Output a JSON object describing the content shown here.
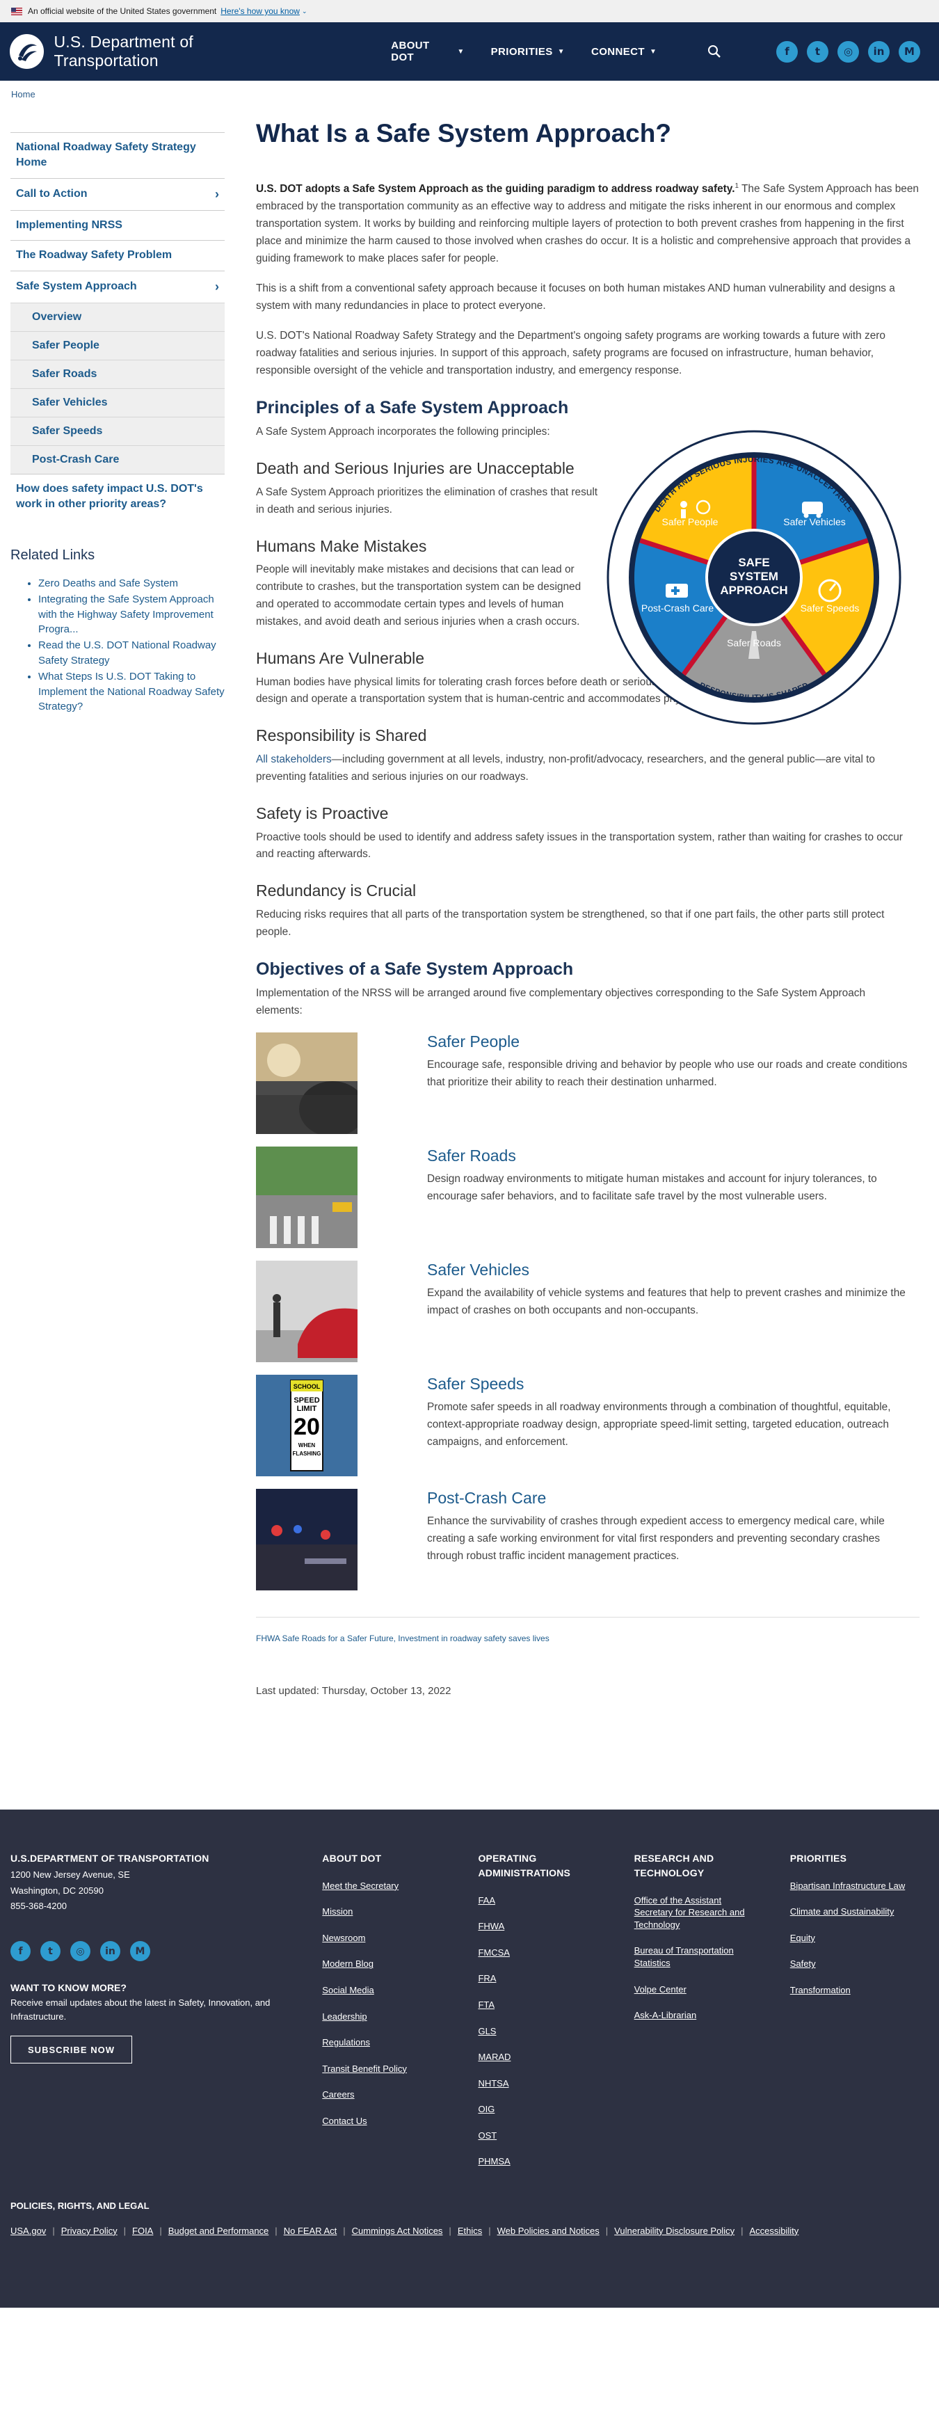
{
  "banner": {
    "text": "An official website of the United States government",
    "link": "Here's how you know"
  },
  "header": {
    "site_name": "U.S. Department of Transportation",
    "nav": [
      {
        "label": "ABOUT DOT"
      },
      {
        "label": "PRIORITIES"
      },
      {
        "label": "CONNECT"
      }
    ],
    "social": [
      {
        "icon": "facebook-icon",
        "glyph": "f"
      },
      {
        "icon": "twitter-icon",
        "glyph": "t"
      },
      {
        "icon": "instagram-icon",
        "glyph": "◎"
      },
      {
        "icon": "linkedin-icon",
        "glyph": "in"
      },
      {
        "icon": "medium-icon",
        "glyph": "M"
      }
    ]
  },
  "breadcrumb": {
    "home": "Home"
  },
  "sidebar": {
    "items": [
      {
        "label": "National Roadway Safety Strategy Home"
      },
      {
        "label": "Call to Action",
        "arrow": "›"
      },
      {
        "label": "Implementing NRSS"
      },
      {
        "label": "The Roadway Safety Problem"
      },
      {
        "label": "Safe System Approach",
        "arrow": "›"
      }
    ],
    "subitems": [
      {
        "label": "Overview"
      },
      {
        "label": "Safer People"
      },
      {
        "label": "Safer Roads"
      },
      {
        "label": "Safer Vehicles"
      },
      {
        "label": "Safer Speeds"
      },
      {
        "label": "Post-Crash Care"
      }
    ],
    "last_item": {
      "label": "How does safety impact U.S. DOT's work in other priority areas?"
    },
    "related_title": "Related Links",
    "related": [
      {
        "label": "Zero Deaths and Safe System"
      },
      {
        "label": "Integrating the Safe System Approach with the Highway Safety Improvement Progra..."
      },
      {
        "label": "Read the U.S. DOT National Roadway Safety Strategy"
      },
      {
        "label": "What Steps Is U.S. DOT Taking to Implement the National Roadway Safety Strategy?"
      }
    ]
  },
  "main": {
    "title": "What Is a Safe System Approach?",
    "lead_bold": "U.S. DOT adopts a Safe System Approach as the guiding paradigm to address roadway safety.",
    "lead_sup": "1",
    "lead_rest": " The Safe System Approach has been embraced by the transportation community as an effective way to address and mitigate the risks inherent in our enormous and complex transportation system. It works by building and reinforcing multiple layers of protection to both prevent crashes from happening in the first place and minimize the harm caused to those involved when crashes do occur. It is a holistic and comprehensive approach that provides a guiding framework to make places safer for people.",
    "para2": "This is a shift from a conventional safety approach because it focuses on both human mistakes AND human vulnerability and designs a system with many redundancies in place to protect everyone.",
    "para3": "U.S. DOT's National Roadway Safety Strategy and the Department's ongoing safety programs are working towards a future with zero roadway fatalities and serious injuries. In support of this approach, safety programs are focused on infrastructure, human behavior, responsible oversight of the vehicle and transportation industry, and emergency response.",
    "principles_title": "Principles of a Safe System Approach",
    "principles_intro": "A Safe System Approach incorporates the following principles:",
    "principles": [
      {
        "title": "Death and Serious Injuries are Unacceptable",
        "text": "A Safe System Approach prioritizes the elimination of crashes that result in death and serious injuries."
      },
      {
        "title": "Humans Make Mistakes",
        "text": "People will inevitably make mistakes and decisions that can lead or contribute to crashes, but the transportation system can be designed and operated to accommodate certain types and levels of human mistakes, and avoid death and serious injuries when a crash occurs."
      },
      {
        "title": "Humans Are Vulnerable",
        "text": "Human bodies have physical limits for tolerating crash forces before death or serious injury occurs; therefore, it is critical to design and operate a transportation system that is human-centric and accommodates physical human vulnerabilities."
      },
      {
        "title": "Responsibility is Shared",
        "link": "All stakeholders",
        "text": "—including government at all levels, industry, non-profit/advocacy, researchers, and the general public—are vital to preventing fatalities and serious injuries on our roadways."
      },
      {
        "title": "Safety is Proactive",
        "text": "Proactive tools should be used to identify and address safety issues in the transportation system, rather than waiting for crashes to occur and reacting afterwards."
      },
      {
        "title": "Redundancy is Crucial",
        "text": "Reducing risks requires that all parts of the transportation system be strengthened, so that if one part fails, the other parts still protect people."
      }
    ],
    "wheel": {
      "center": [
        "SAFE",
        "SYSTEM",
        "APPROACH"
      ],
      "segments": [
        "Safer People",
        "Safer Vehicles",
        "Safer Speeds",
        "Safer Roads",
        "Post-Crash Care"
      ],
      "ring": [
        "DEATH AND SERIOUS INJURIES ARE UNACCEPTABLE",
        "HUMANS MAKE MISTAKES",
        "HUMANS ARE VULNERABLE",
        "RESPONSIBILITY IS SHARED",
        "SAFETY IS PROACTIVE",
        "REDUNDANCY IS CRUCIAL"
      ],
      "colors": {
        "yellow": "#ffc20e",
        "blue": "#1b7fc9",
        "gray": "#9a9a9a",
        "navy": "#13284c",
        "red": "#c8102e"
      }
    },
    "objectives_title": "Objectives of a Safe System Approach",
    "objectives_intro": "Implementation of the NRSS will be arranged around five complementary objectives corresponding to the Safe System Approach elements:",
    "objectives": [
      {
        "title": "Safer People",
        "text": "Encourage safe, responsible driving and behavior by people who use our roads and create conditions that prioritize their ability to reach their destination unharmed."
      },
      {
        "title": "Safer Roads",
        "text": "Design roadway environments to mitigate human mistakes and account for injury tolerances, to encourage safer behaviors, and to facilitate safe travel by the most vulnerable users."
      },
      {
        "title": "Safer Vehicles",
        "text": "Expand the availability of vehicle systems and features that help to prevent crashes and minimize the impact of crashes on both occupants and non-occupants."
      },
      {
        "title": "Safer Speeds",
        "text": "Promote safer speeds in all roadway environments through a combination of thoughtful, equitable, context-appropriate roadway design, appropriate speed-limit setting, targeted education, outreach campaigns, and enforcement."
      },
      {
        "title": "Post-Crash Care",
        "text": "Enhance the survivability of crashes through expedient access to emergency medical care, while creating a safe working environment for vital first responders and preventing secondary crashes through robust traffic incident management practices."
      }
    ],
    "speed_sign": {
      "top": "SCHOOL",
      "l1": "SPEED",
      "l2": "LIMIT",
      "num": "20",
      "b1": "WHEN",
      "b2": "FLASHING"
    },
    "footnote": "FHWA Safe Roads for a Safer Future, Investment in roadway safety saves lives",
    "updated": "Last updated: Thursday, October 13, 2022"
  },
  "footer": {
    "org": "U.S.DEPARTMENT OF TRANSPORTATION",
    "address": [
      "1200 New Jersey Avenue, SE",
      "Washington, DC 20590",
      "855-368-4200"
    ],
    "want_title": "WANT TO KNOW MORE?",
    "want_desc": "Receive email updates about the latest in Safety, Innovation, and Infrastructure.",
    "subscribe": "SUBSCRIBE NOW",
    "columns": [
      {
        "title": "ABOUT DOT",
        "links": [
          "Meet the Secretary",
          "Mission",
          "Newsroom",
          "Modern Blog",
          "Social Media",
          "Leadership",
          "Regulations",
          "Transit Benefit Policy",
          "Careers",
          "Contact Us"
        ]
      },
      {
        "title": "OPERATING ADMINISTRATIONS",
        "links": [
          "FAA",
          "FHWA",
          "FMCSA",
          "FRA",
          "FTA",
          "GLS",
          "MARAD",
          "NHTSA",
          "OIG",
          "OST",
          "PHMSA"
        ]
      },
      {
        "title": "RESEARCH AND TECHNOLOGY",
        "links": [
          "Office of the Assistant Secretary for Research and Technology",
          "Bureau of Transportation Statistics",
          "Volpe Center",
          "Ask-A-Librarian"
        ]
      },
      {
        "title": "PRIORITIES",
        "links": [
          "Bipartisan Infrastructure Law",
          "Climate and Sustainability",
          "Equity",
          "Safety",
          "Transformation"
        ]
      }
    ],
    "policies_title": "POLICIES, RIGHTS, AND LEGAL",
    "policies": [
      "USA.gov",
      "Privacy Policy",
      "FOIA",
      "Budget and Performance",
      "No FEAR Act",
      "Cummings Act Notices",
      "Ethics",
      "Web Policies and Notices",
      "Vulnerability Disclosure Policy",
      "Accessibility"
    ]
  }
}
